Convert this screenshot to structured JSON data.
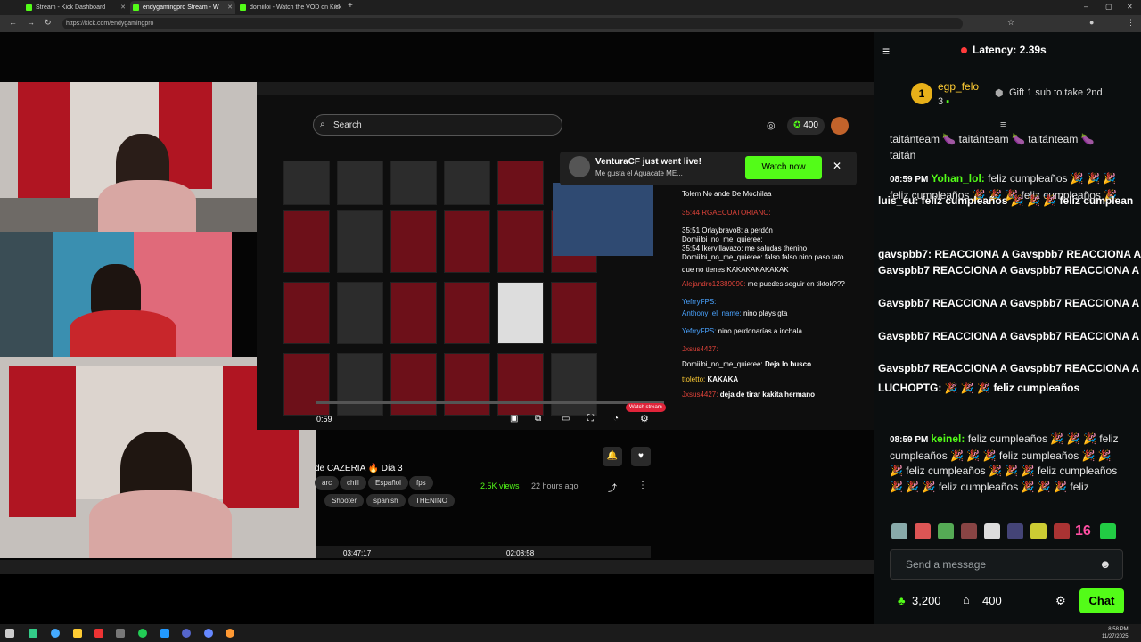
{
  "tabs": [
    {
      "title": "Stream - Kick Dashboard"
    },
    {
      "title": "endygamingpro Stream - W"
    },
    {
      "title": "domiiloi - Watch the VOD on Kick"
    }
  ],
  "address": {
    "url": "https://kick.com/endygamingpro"
  },
  "inner_page": {
    "search_placeholder": "Search",
    "points": "400",
    "notification": {
      "title": "VenturaCF just went live!",
      "subtitle": "Me gusta el Aguacate ME...",
      "button": "Watch now"
    },
    "chat": [
      {
        "user": "",
        "text": "Tolem No ande De Mochilaa"
      },
      {
        "user": "35:44 RGAECUATORIANO:",
        "text": ""
      },
      {
        "user": "35:51 Orlaybravo8:",
        "text": "a perdón"
      },
      {
        "user": "Domiiloi_no_me_quieree:",
        "text": ""
      },
      {
        "user": "35:54 Ikervillavazo:",
        "text": "me saludas thenino"
      },
      {
        "user": "Domiiloi_no_me_quieree:",
        "text": "falso falso nino paso tato"
      },
      {
        "user": "",
        "text": "que no tienes KAKAKAKAKAKAK"
      },
      {
        "user": "Alejandro12389090:",
        "text": "me puedes seguir en tiktok???"
      },
      {
        "user": "YefrryFPS:",
        "text": ""
      },
      {
        "user": "Anthony_el_name:",
        "text": "nino plays gta"
      },
      {
        "user": "YefrryFPS:",
        "text": "nino perdonarías a inchala"
      },
      {
        "user": "Jxsus4427:",
        "text": ""
      },
      {
        "user": "Domiiloi_no_me_quieree:",
        "text": "Deja lo busco"
      },
      {
        "user": "ttoletto:",
        "text": "KAKAKA"
      },
      {
        "user": "Jxsus4427:",
        "text": "deja de tirar kakita hermano"
      }
    ],
    "vod_title": "de CAZERIA 🔥 Día 3",
    "tags_row1": [
      "arc",
      "chill",
      "Español",
      "fps"
    ],
    "tags_row2": [
      "Shooter",
      "spanish",
      "THENINO"
    ],
    "views": "2.5K views",
    "ago": "22 hours ago",
    "timecode": "0:59",
    "durations": [
      "03:47:17",
      "02:08:58"
    ],
    "live_label": "Watch stream"
  },
  "chat_panel": {
    "latency": "Latency: 2.39s",
    "top_gifter": {
      "rank": "1",
      "name": "egp_felo",
      "count": "3"
    },
    "gift_label": "Gift 1 sub to take 2nd",
    "messages": [
      {
        "time": "",
        "user": "",
        "text": "taitánteam 🍆 taitánteam 🍆 taitánteam 🍆 taitán"
      },
      {
        "time": "08:59 PM",
        "user": "Yohan_lol:",
        "text": "feliz cumpleaños 🎉 🎉 🎉 feliz cumpleaños 🎉 🎉 🎉 feliz cumpleaños 🎉"
      },
      {
        "time": "08:59 PM",
        "user": "keinel:",
        "text": "feliz cumpleaños 🎉 🎉 🎉 feliz cumpleaños 🎉 🎉 🎉 feliz cumpleaños 🎉 🎉 🎉 feliz cumpleaños 🎉 🎉 🎉 feliz cumpleaños 🎉 🎉 🎉 feliz cumpleaños 🎉 🎉 🎉 feliz"
      }
    ],
    "overlay_spam": [
      "luis_eu: feliz cumpleaños 🎉 🎉 🎉 feliz cumplean",
      "gavspbb7: REACCIONA A Gavspbb7 REACCIONA A Ga",
      "Gavspbb7 REACCIONA A Gavspbb7 REACCIONA A Ga",
      "LUCHOPTG: 🎉 🎉 🎉 feliz cumpleaños"
    ],
    "input_placeholder": "Send a message",
    "points": "3,200",
    "points2": "400",
    "chat_button": "Chat",
    "emote_badge": "16"
  },
  "system": {
    "time": "8:58 PM",
    "date": "11/27/2025"
  },
  "colors": {
    "kick_green": "#53fc18",
    "curtain_red": "#b01522",
    "panel_bg": "#0b0e0f"
  }
}
